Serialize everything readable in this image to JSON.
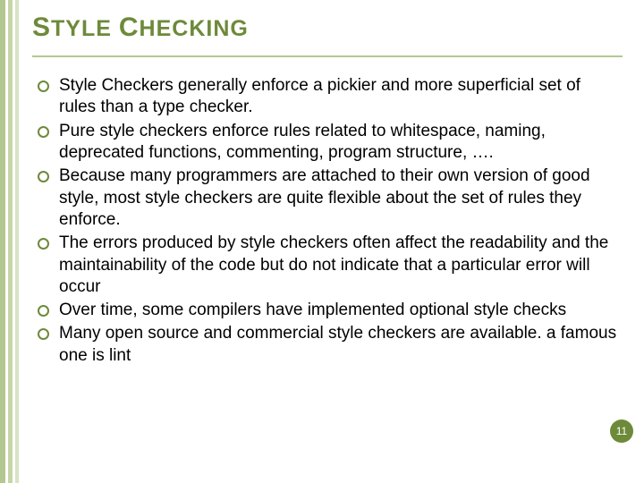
{
  "title": {
    "word1_cap": "S",
    "word1_rest": "TYLE",
    "word2_cap": "C",
    "word2_rest": "HECKING"
  },
  "bullets": [
    "Style Checkers generally enforce a pickier and more superficial set of rules than a type checker.",
    " Pure style checkers enforce rules related to whitespace, naming, deprecated functions, commenting, program structure, ….",
    "Because many programmers are attached to their own version of good style, most style checkers are quite flexible about the set of rules they enforce.",
    "The errors produced by style checkers often affect the readability and the maintainability of the code but do not indicate that a particular error will occur",
    "Over time, some compilers have implemented optional style checks",
    "Many open source and commercial style checkers are available. a famous one is lint"
  ],
  "page_number": "11"
}
